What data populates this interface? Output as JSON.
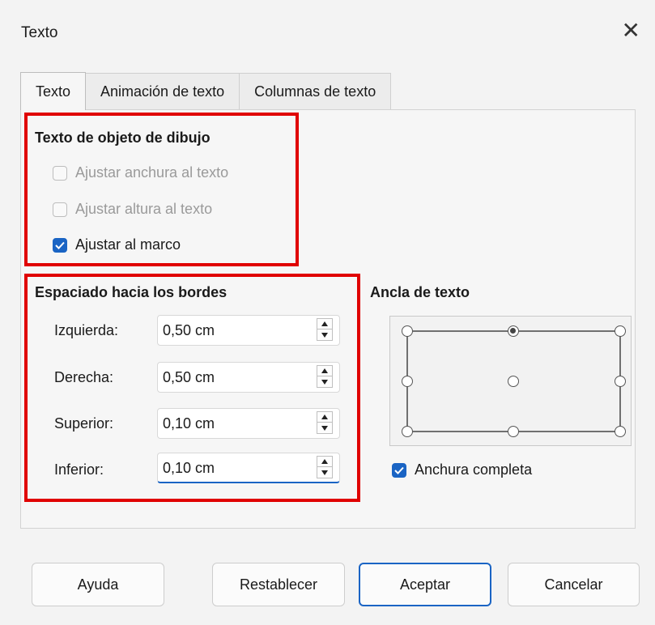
{
  "window": {
    "title": "Texto",
    "close_glyph": "✕"
  },
  "tabs": [
    {
      "label": "Texto",
      "active": true
    },
    {
      "label": "Animación de texto",
      "active": false
    },
    {
      "label": "Columnas de texto",
      "active": false
    }
  ],
  "drawing_text": {
    "title": "Texto de objeto de dibujo",
    "options": [
      {
        "label": "Ajustar anchura al texto",
        "checked": false,
        "enabled": false
      },
      {
        "label": "Ajustar altura al texto",
        "checked": false,
        "enabled": false
      },
      {
        "label": "Ajustar al marco",
        "checked": true,
        "enabled": true
      }
    ]
  },
  "spacing": {
    "title": "Espaciado hacia los bordes",
    "fields": [
      {
        "label": "Izquierda:",
        "value": "0,50 cm"
      },
      {
        "label": "Derecha:",
        "value": "0,50 cm"
      },
      {
        "label": "Superior:",
        "value": "0,10 cm"
      },
      {
        "label": "Inferior:",
        "value": "0,10 cm"
      }
    ]
  },
  "anchor": {
    "title": "Ancla de texto",
    "selected": "top-center",
    "full_width": {
      "label": "Anchura completa",
      "checked": true
    }
  },
  "buttons": {
    "help": "Ayuda",
    "reset": "Restablecer",
    "ok": "Aceptar",
    "cancel": "Cancelar"
  },
  "colors": {
    "accent": "#1a64c4",
    "highlight": "#e00000"
  }
}
